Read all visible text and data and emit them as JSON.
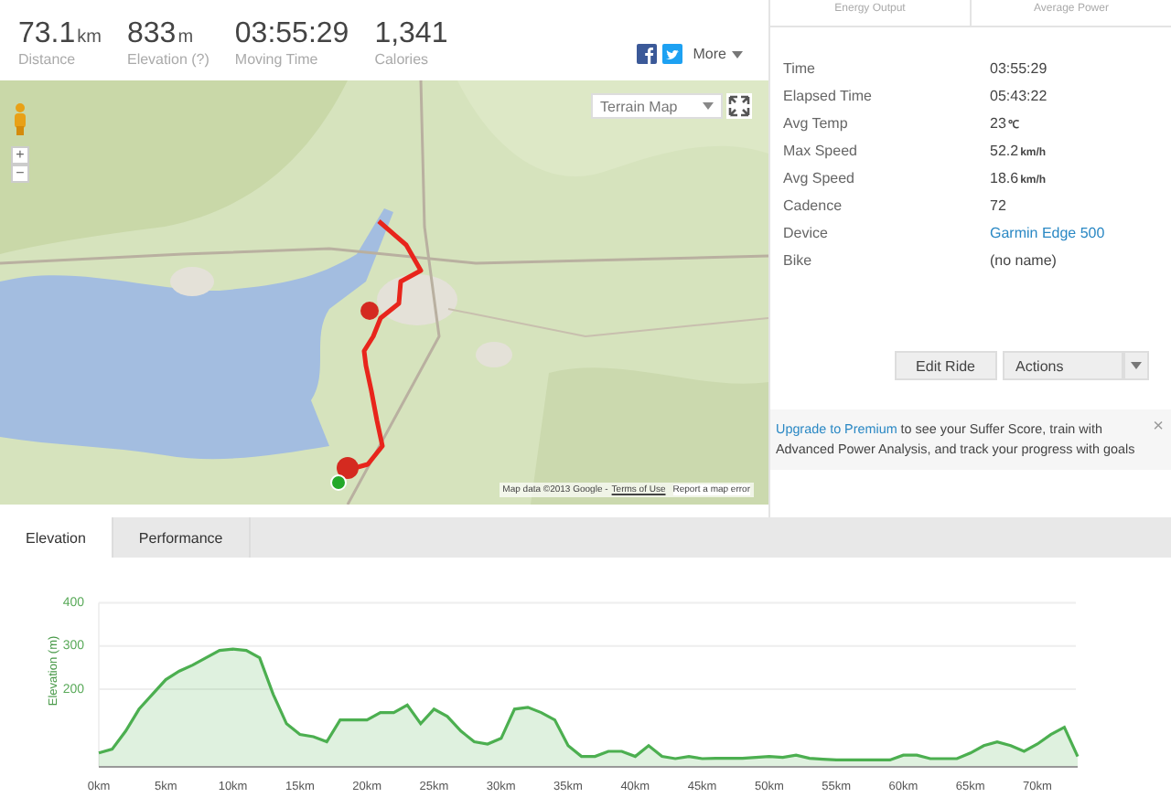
{
  "stats": [
    {
      "value": "73.1",
      "unit": "km",
      "label": "Distance"
    },
    {
      "value": "833",
      "unit": "m",
      "label": "Elevation (?)"
    },
    {
      "value": "03:55:29",
      "label": "Moving Time"
    },
    {
      "value": "1,341",
      "label": "Calories"
    }
  ],
  "share": {
    "more": "More"
  },
  "map": {
    "type_select": "Terrain Map",
    "attribution": "Map data ©2013 Google -",
    "terms": "Terms of Use",
    "report": "Report a map error",
    "zoom_in": "+",
    "zoom_out": "−"
  },
  "power_tabs": [
    "Energy Output",
    "Average Power"
  ],
  "details": [
    {
      "label": "Time",
      "value": "03:55:29",
      "kind": "text"
    },
    {
      "label": "Elapsed Time",
      "value": "05:43:22",
      "kind": "text"
    },
    {
      "label": "Avg Temp",
      "value": "23",
      "unit": "℃",
      "kind": "text"
    },
    {
      "label": "Max Speed",
      "value": "52.2",
      "unit": "km/h",
      "kind": "text"
    },
    {
      "label": "Avg Speed",
      "value": "18.6",
      "unit": "km/h",
      "kind": "text"
    },
    {
      "label": "Cadence",
      "value": "72",
      "kind": "text"
    },
    {
      "label": "Device",
      "value": "Garmin Edge 500",
      "kind": "link"
    },
    {
      "label": "Bike",
      "value": "(no name)",
      "kind": "text"
    }
  ],
  "buttons": {
    "edit": "Edit Ride",
    "actions": "Actions"
  },
  "upgrade": {
    "link": "Upgrade to Premium",
    "text": " to see your Suffer Score, train with Advanced Power Analysis, and track your progress with goals",
    "close": "×"
  },
  "chart_tabs": [
    {
      "label": "Elevation",
      "selected": true
    },
    {
      "label": "Performance",
      "selected": false
    }
  ],
  "chart_data": {
    "type": "area",
    "ylabel": "Elevation (m)",
    "grid": true,
    "ylim": [
      20,
      400
    ],
    "xlim": [
      0,
      73
    ],
    "yticks": [
      200,
      300,
      400
    ],
    "xticks": [
      {
        "value": 0,
        "label": "0km"
      },
      {
        "value": 5,
        "label": "5km"
      },
      {
        "value": 10,
        "label": "10km"
      },
      {
        "value": 15,
        "label": "15km"
      },
      {
        "value": 20,
        "label": "20km"
      },
      {
        "value": 25,
        "label": "25km"
      },
      {
        "value": 30,
        "label": "30km"
      },
      {
        "value": 35,
        "label": "35km"
      },
      {
        "value": 40,
        "label": "40km"
      },
      {
        "value": 45,
        "label": "45km"
      },
      {
        "value": 50,
        "label": "50km"
      },
      {
        "value": 55,
        "label": "55km"
      },
      {
        "value": 60,
        "label": "60km"
      },
      {
        "value": 65,
        "label": "65km"
      },
      {
        "value": 70,
        "label": "70km"
      }
    ],
    "x": [
      0,
      1,
      2,
      3,
      4,
      5,
      6,
      7,
      8,
      9,
      10,
      11,
      12,
      13,
      14,
      15,
      16,
      17,
      18,
      19,
      20,
      21,
      22,
      23,
      24,
      25,
      26,
      27,
      28,
      29,
      30,
      31,
      32,
      33,
      34,
      35,
      36,
      37,
      38,
      39,
      40,
      41,
      42,
      43,
      44,
      45,
      46,
      47,
      48,
      49,
      50,
      51,
      52,
      53,
      54,
      55,
      56,
      57,
      58,
      59,
      60,
      61,
      62,
      63,
      64,
      65,
      66,
      67,
      68,
      69,
      70,
      71,
      72,
      73
    ],
    "series": [
      {
        "color": "#4caf50",
        "values": [
          52,
          61,
          103,
          154,
          188,
          222,
          242,
          256,
          273,
          290,
          293,
          290,
          273,
          188,
          120,
          95,
          90,
          78,
          129,
          129,
          129,
          146,
          146,
          163,
          120,
          154,
          137,
          103,
          78,
          73,
          86,
          154,
          158,
          146,
          129,
          69,
          44,
          44,
          56,
          56,
          44,
          69,
          44,
          39,
          44,
          39,
          40,
          40,
          40,
          42,
          44,
          42,
          47,
          40,
          38,
          36,
          36,
          36,
          36,
          36,
          47,
          47,
          39,
          39,
          39,
          52,
          69,
          78,
          69,
          56,
          73,
          95,
          112,
          44
        ]
      }
    ]
  }
}
